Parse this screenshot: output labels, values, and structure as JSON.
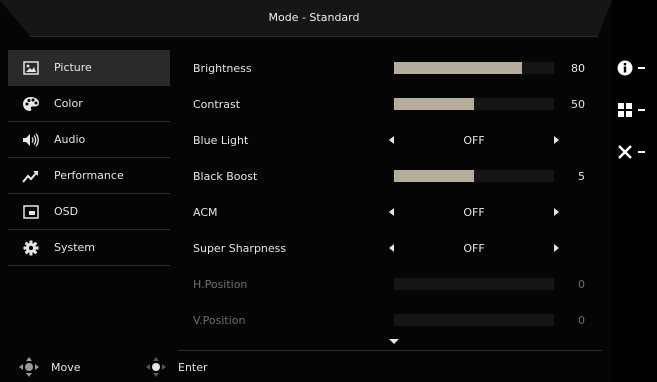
{
  "header": {
    "title": "Mode - Standard"
  },
  "sidebar": {
    "items": [
      {
        "label": "Picture",
        "icon": "picture-icon",
        "active": true
      },
      {
        "label": "Color",
        "icon": "color-palette-icon"
      },
      {
        "label": "Audio",
        "icon": "speaker-icon"
      },
      {
        "label": "Performance",
        "icon": "performance-trend-icon"
      },
      {
        "label": "OSD",
        "icon": "osd-window-icon"
      },
      {
        "label": "System",
        "icon": "gear-icon"
      }
    ]
  },
  "settings": {
    "brightness": {
      "label": "Brightness",
      "value": "80",
      "level": 80
    },
    "contrast": {
      "label": "Contrast",
      "value": "50",
      "level": 50
    },
    "blue_light": {
      "label": "Blue Light",
      "value": "OFF"
    },
    "black_boost": {
      "label": "Black Boost",
      "value": "5",
      "level": 50
    },
    "acm": {
      "label": "ACM",
      "value": "OFF"
    },
    "super_sharpness": {
      "label": "Super Sharpness",
      "value": "OFF"
    },
    "h_position": {
      "label": "H.Position",
      "value": "0",
      "level": 0
    },
    "v_position": {
      "label": "V.Position",
      "value": "0",
      "level": 0
    }
  },
  "footer": {
    "move_label": "Move",
    "enter_label": "Enter"
  },
  "hotkeys": [
    {
      "icon": "info-icon"
    },
    {
      "icon": "grid-icon"
    },
    {
      "icon": "close-icon"
    }
  ],
  "colors": {
    "bar_fill": "#b5ad9a",
    "bar_track": "#151515",
    "active_bg": "#2a2a2a"
  }
}
